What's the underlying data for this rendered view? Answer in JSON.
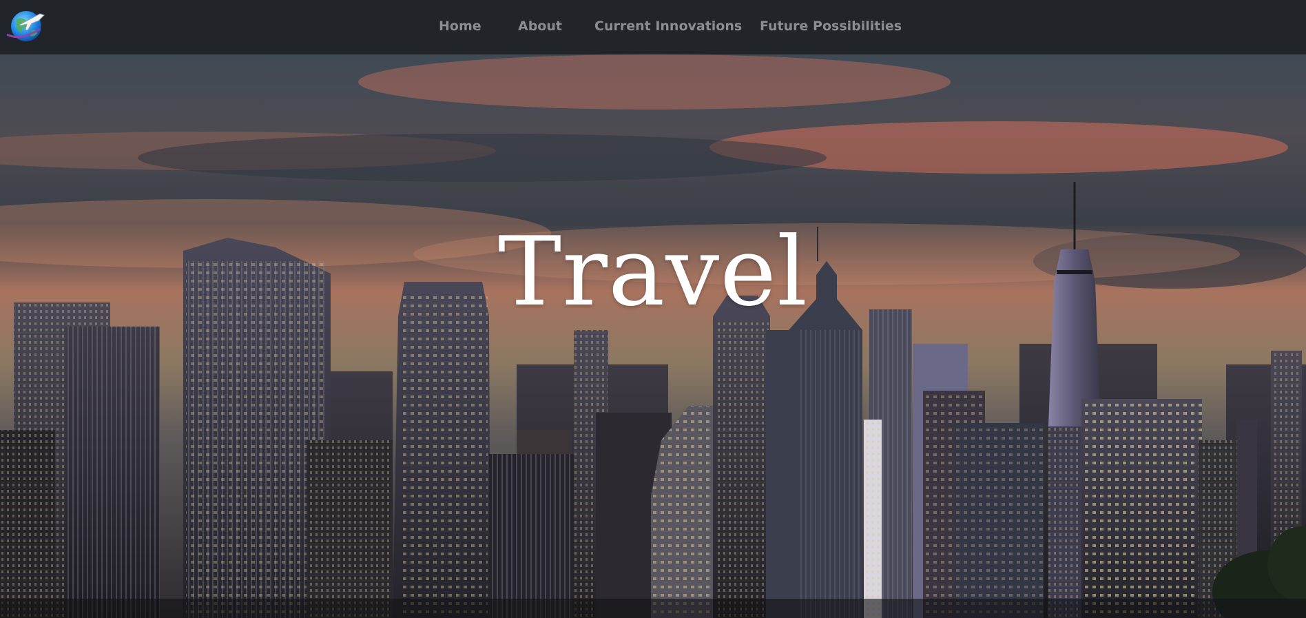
{
  "navbar": {
    "logo_icon": "globe-airplane-icon",
    "links": [
      {
        "label": "Home"
      },
      {
        "label": "About"
      },
      {
        "label": "Current Innovations"
      },
      {
        "label": "Future Possibilities"
      }
    ]
  },
  "hero": {
    "title": "Travel",
    "background_icon": "city-skyline-at-dusk-image"
  },
  "colors": {
    "navbar_bg": "#212529",
    "nav_link": "#8a8d91",
    "title": "#ffffff"
  }
}
